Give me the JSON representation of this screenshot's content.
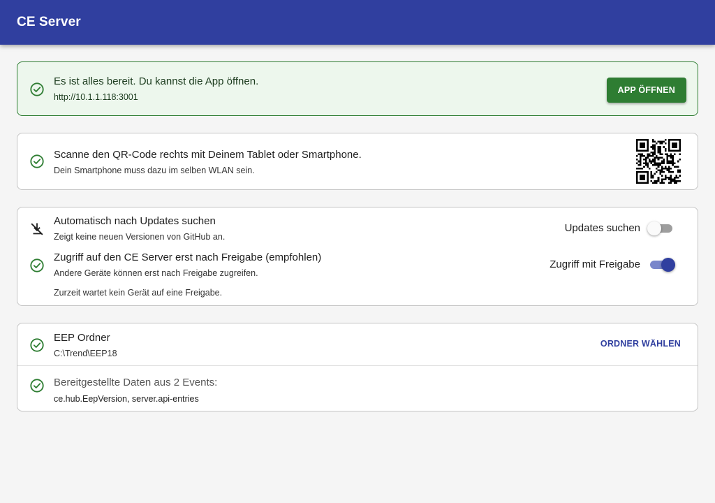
{
  "appbar": {
    "title": "CE Server"
  },
  "ready": {
    "message": "Es ist alles bereit. Du kannst die App öffnen.",
    "url": "http://10.1.1.118:3001",
    "button_label": "APP ÖFFNEN"
  },
  "qr_card": {
    "primary": "Scanne den QR-Code rechts mit Deinem Tablet oder Smartphone.",
    "secondary": "Dein Smartphone muss dazu im selben WLAN sein."
  },
  "settings": {
    "updates": {
      "primary": "Automatisch nach Updates suchen",
      "secondary": "Zeigt keine neuen Versionen von GitHub an.",
      "switch_label": "Updates suchen",
      "checked": false
    },
    "access": {
      "primary": "Zugriff auf den CE Server erst nach Freigabe (empfohlen)",
      "secondary": "Andere Geräte können erst nach Freigabe zugreifen.",
      "switch_label": "Zugriff mit Freigabe",
      "checked": true
    },
    "waiting_text": "Zurzeit wartet kein Gerät auf eine Freigabe."
  },
  "eep": {
    "folder_title": "EEP Ordner",
    "folder_path": "C:\\Trend\\EEP18",
    "choose_button": "ORDNER WÄHLEN",
    "events_title": "Bereitgestellte Daten aus 2 Events:",
    "events_list": "ce.hub.EepVersion, server.api-entries"
  },
  "colors": {
    "primary": "#303f9f",
    "success": "#2e7d32",
    "success_bg": "#edf7ed"
  },
  "icons": {
    "check": "check-circle-outline-icon",
    "no_updates": "update-disabled-icon"
  }
}
